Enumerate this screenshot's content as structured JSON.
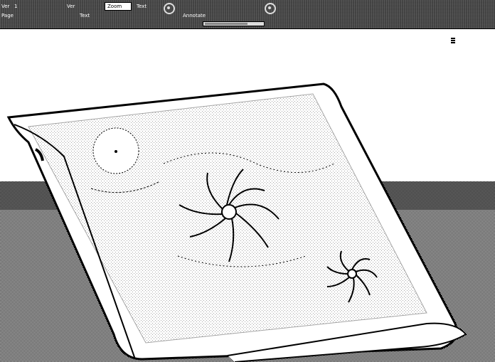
{
  "toolbar": {
    "row1": [
      {
        "name": "menu-item-1",
        "label": "Ver"
      },
      {
        "name": "menu-item-2",
        "label": "1"
      },
      {
        "name": "menu-item-3",
        "label": "Ver"
      },
      {
        "name": "zoom-select",
        "label": "Zoom"
      },
      {
        "name": "menu-item-5",
        "label": "Text"
      }
    ],
    "row2": [
      {
        "name": "ribbon-link-1",
        "label": "Page"
      },
      {
        "name": "ribbon-link-2",
        "label": "Text"
      },
      {
        "name": "ribbon-link-3",
        "label": "Annotate"
      }
    ],
    "right_row1": {
      "name": "right-label-1",
      "label": ""
    },
    "right_row2": {
      "name": "right-label-2",
      "label": ""
    }
  },
  "colors": {
    "ribbon_bg": "#4a4a4a",
    "canvas_bg": "#ffffff",
    "floor": "#7a7a7a",
    "ink": "#000000"
  },
  "icons": [
    "circle-tool-icon",
    "circle-tool-icon",
    "resize-grip-icon"
  ]
}
